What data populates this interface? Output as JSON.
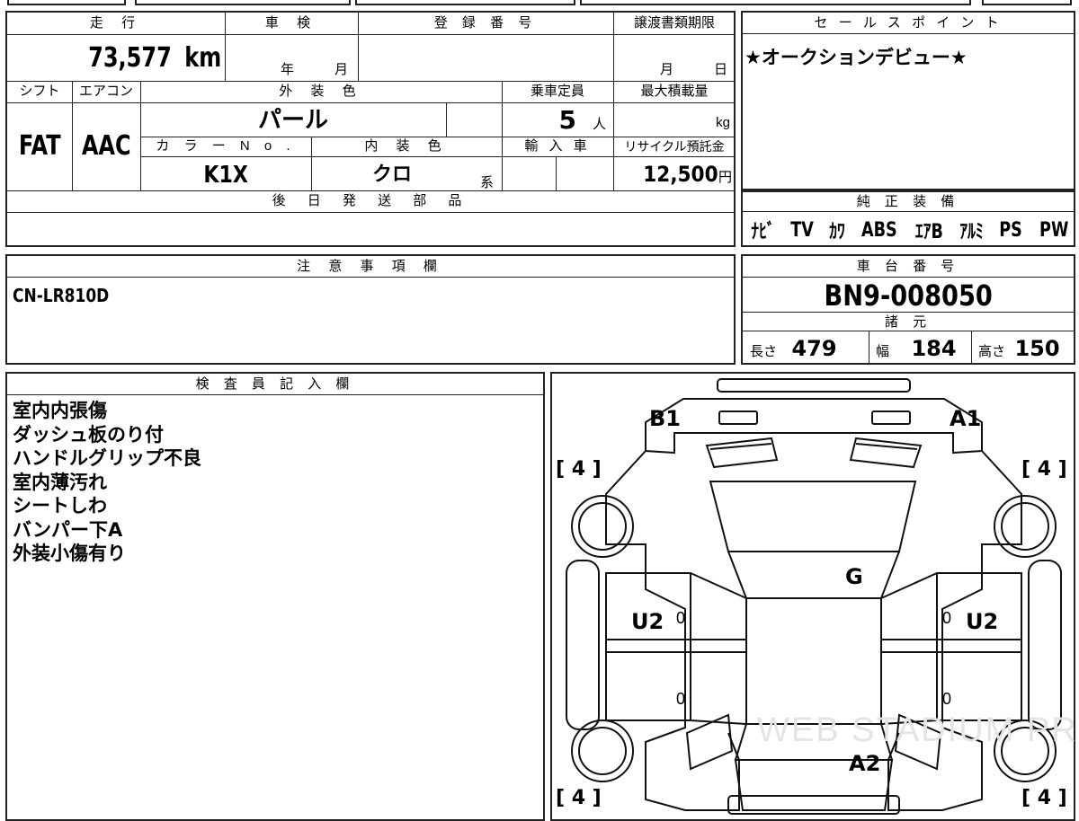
{
  "top_table": {
    "mileage_label": "走 行",
    "mileage_value": "73,577",
    "mileage_unit": "km",
    "inspection_label": "車 検",
    "inspection_year_unit": "年",
    "inspection_month_unit": "月",
    "registration_label": "登 録 番 号",
    "transfer_label": "譲渡書類期限",
    "transfer_month_unit": "月",
    "transfer_day_unit": "日",
    "shift_label": "シフト",
    "shift_value": "FAT",
    "aircon_label": "エアコン",
    "aircon_value": "AAC",
    "exterior_label": "外 装 色",
    "exterior_value": "パール",
    "capacity_label": "乗車定員",
    "capacity_value": "5",
    "capacity_unit": "人",
    "max_load_label": "最大積載量",
    "max_load_unit": "kg",
    "color_no_label": "カ ラ ー N o .",
    "color_no_value": "K1X",
    "interior_label": "内 装 色",
    "interior_value": "クロ",
    "interior_suffix": "系",
    "import_label": "輸 入 車",
    "recycle_label": "リサイクル預託金",
    "recycle_value": "12,500",
    "recycle_unit": "円",
    "parts_label": "後 日 発 送 部 品"
  },
  "sales_point": {
    "label": "セ ー ル ス ポ イ ン ト",
    "text": "★オークションデビュー★"
  },
  "equipment": {
    "label": "純 正 装 備",
    "items": [
      "ﾅﾋﾞ",
      "TV",
      "ｶﾜ",
      "ABS",
      "ｴｱB",
      "ｱﾙﾐ",
      "PS",
      "PW"
    ]
  },
  "notes": {
    "label": "注 意 事 項 欄",
    "text": "CN-LR810D"
  },
  "chassis": {
    "label": "車 台 番 号",
    "value": "BN9-008050",
    "spec_label": "諸 元",
    "length_label": "長さ",
    "length_value": "479",
    "width_label": "幅",
    "width_value": "184",
    "height_label": "高さ",
    "height_value": "150"
  },
  "inspector": {
    "label": "検 査 員 記 入 欄",
    "lines": [
      "室内内張傷",
      "ダッシュ板のり付",
      "ハンドルグリップ不良",
      "室内薄汚れ",
      "シートしわ",
      "バンパー下A",
      "外装小傷有り"
    ]
  },
  "diagram": {
    "marks": {
      "b1": "B1",
      "a1": "A1",
      "g": "G",
      "u2_left": "U2",
      "u2_right": "U2",
      "a2": "A2",
      "zero_l_top": "0",
      "zero_r_top": "0",
      "zero_l_bot": "0",
      "zero_r_bot": "0"
    },
    "tires": {
      "front_left": "[ 4 ]",
      "front_right": "[ 4 ]",
      "rear_left": "[ 4 ]",
      "rear_right": "[ 4 ]"
    },
    "watermark": "WEB STADIUM PRO"
  }
}
